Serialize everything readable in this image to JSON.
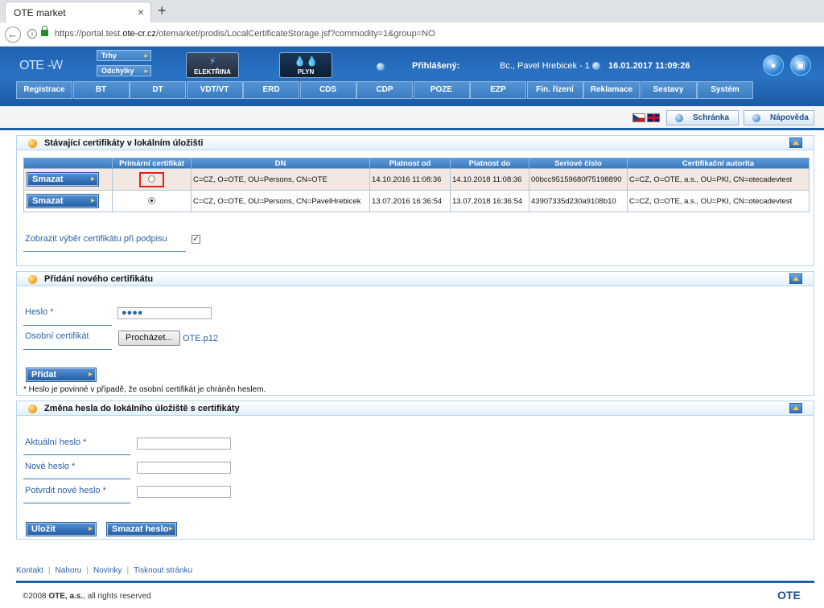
{
  "browser": {
    "tab_title": "OTE market",
    "tab_close": "×",
    "new_tab": "+",
    "url_prefix": "https://portal.test.",
    "url_domain": "ote-cr.cz",
    "url_rest": "/otemarket/prodis/LocalCertificateStorage.jsf?commodity=1&group=NO"
  },
  "header": {
    "logo": "OTE",
    "logo_wave": "-\\/\\/",
    "trhy": "Trhy",
    "odchylky": "Odchylky",
    "elektrina": "ELEKTŘINA",
    "plyn": "PLYN",
    "logged_label": "Přihlášený:",
    "user": "Bc., Pavel Hrebicek - 1",
    "datetime": "16.01.2017 11:09:26"
  },
  "nav": [
    "Registrace",
    "BT",
    "DT",
    "VDT/VT",
    "ERD",
    "CDS",
    "CDP",
    "POZE",
    "EZP",
    "Fin. řízení",
    "Reklamace",
    "Sestavy",
    "Systém"
  ],
  "toolbar": {
    "schranka": "Schránka",
    "napoveda": "Nápověda"
  },
  "colors": {
    "brand_blue": "#1e5ea8",
    "highlight_red": "#e02020",
    "accent_orange": "#f09a10"
  },
  "panel1": {
    "title": "Stávající certifikáty v lokálním úložišti",
    "columns": [
      "",
      "Primární certifikát",
      "DN",
      "Platnost od",
      "Platnost do",
      "Seriové číslo",
      "Certifikační autorita"
    ],
    "rows": [
      {
        "action": "Smazat",
        "dn": "C=CZ, O=OTE, OU=Persons, CN=OTE",
        "from": "14.10.2016 11:08:36",
        "to": "14.10.2018 11:08:36",
        "serial": "00bcc95159680f75198890",
        "ca": "C=CZ, O=OTE, a.s., OU=PKI, CN=otecadevtest"
      },
      {
        "action": "Smazat",
        "dn": "C=CZ, O=OTE, OU=Persons, CN=PavelHrebicek",
        "from": "13.07.2016 16:36:54",
        "to": "13.07.2018 16:36:54",
        "serial": "43907335d230a9108b10",
        "ca": "C=CZ, O=OTE, a.s., OU=PKI, CN=otecadevtest"
      }
    ],
    "show_selection_label": "Zobrazit výběr certifikátu při podpisu",
    "checkbox_mark": "✓"
  },
  "panel2": {
    "title": "Přidání nového certifikátu",
    "password_label": "Heslo *",
    "password_value": "●●●●",
    "cert_label": "Osobní certifikát",
    "browse_label": "Procházet...",
    "file_name": "OTE.p12",
    "add_button": "Přidat",
    "note": "* Heslo je povinné v případě, že osobní certifikát je chráněn heslem."
  },
  "panel3": {
    "title": "Změna hesla do lokálního úložiště s certifikáty",
    "current_label": "Aktuální heslo *",
    "new_label": "Nové heslo *",
    "confirm_label": "Potvrdit nové heslo *",
    "save_button": "Uložit",
    "delete_button": "Smazat heslo"
  },
  "footer": {
    "links": [
      "Kontakt",
      "Nahoru",
      "Novinky",
      "Tisknout stránku"
    ],
    "sep": "|",
    "copyright_pre": "©2008 ",
    "copyright_bold": "OTE, a.s.",
    "copyright_post": ", all rights reserved",
    "logo": "OTE"
  }
}
